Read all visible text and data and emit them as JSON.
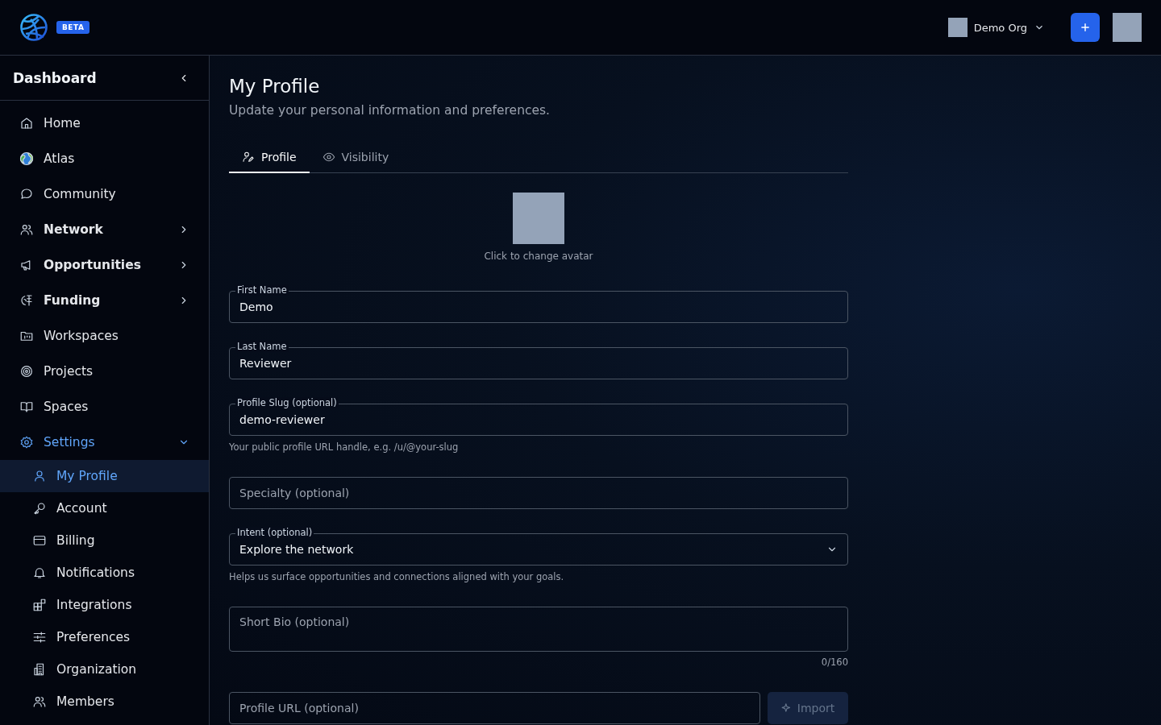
{
  "topbar": {
    "badge": "BETA",
    "org": "Demo Org"
  },
  "sidebar": {
    "title": "Dashboard",
    "items": [
      {
        "label": "Home",
        "selected": false
      },
      {
        "label": "Atlas",
        "selected": false
      },
      {
        "label": "Community",
        "selected": false
      },
      {
        "label": "Network",
        "selected": false,
        "expanded": false
      },
      {
        "label": "Opportunities",
        "selected": false,
        "expanded": false
      },
      {
        "label": "Funding",
        "selected": false,
        "expanded": false
      },
      {
        "label": "Workspaces",
        "selected": false
      },
      {
        "label": "Projects",
        "selected": false
      },
      {
        "label": "Spaces",
        "selected": false
      },
      {
        "label": "Settings",
        "selected": false,
        "expanded": true,
        "children": [
          {
            "label": "My Profile",
            "selected": true
          },
          {
            "label": "Account",
            "selected": false
          },
          {
            "label": "Billing",
            "selected": false
          },
          {
            "label": "Notifications",
            "selected": false
          },
          {
            "label": "Integrations",
            "selected": false
          },
          {
            "label": "Preferences",
            "selected": false
          },
          {
            "label": "Organization",
            "selected": false
          },
          {
            "label": "Members",
            "selected": false
          }
        ]
      }
    ]
  },
  "page": {
    "title": "My Profile",
    "subtitle": "Update your personal information and preferences."
  },
  "tabs": [
    {
      "label": "Profile",
      "selected": true
    },
    {
      "label": "Visibility",
      "selected": false
    }
  ],
  "avatar_caption": "Click to change avatar",
  "fields": [
    {
      "kind": "text",
      "label": "First Name",
      "value": "Demo"
    },
    {
      "kind": "text",
      "label": "Last Name",
      "value": "Reviewer"
    },
    {
      "kind": "text",
      "label": "Profile Slug (optional)",
      "value": "demo-reviewer",
      "helper": "Your public profile URL handle, e.g. /u/@your-slug"
    },
    {
      "kind": "text",
      "placeholder": "Specialty (optional)"
    },
    {
      "kind": "select",
      "label": "Intent (optional)",
      "value": "Explore the network",
      "helper": "Helps us surface opportunities and connections aligned with your goals."
    },
    {
      "kind": "textarea",
      "placeholder": "Short Bio (optional)",
      "counter": "0/160"
    },
    {
      "kind": "url",
      "placeholder": "Profile URL (optional)",
      "button": "Import"
    }
  ]
}
